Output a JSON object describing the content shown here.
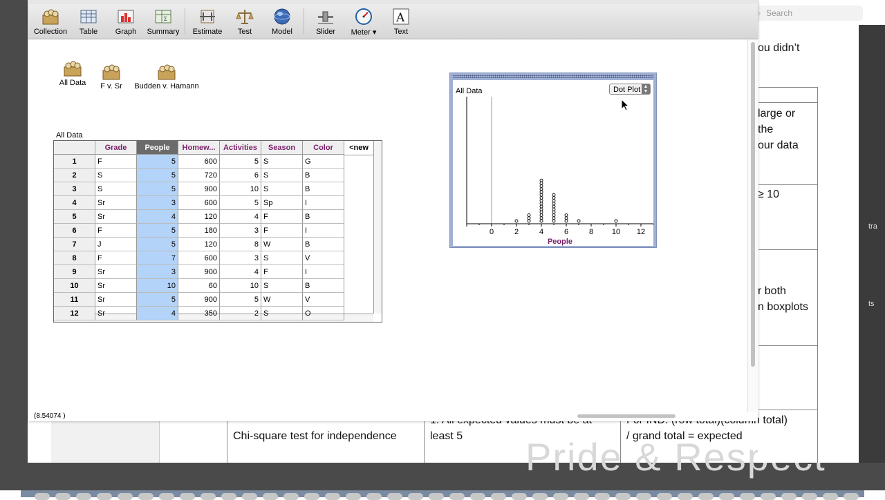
{
  "background": {
    "search_placeholder": "Search",
    "doc_lines": [
      {
        "text": "ou didn’t",
        "x": 1096,
        "y": 58
      },
      {
        "text": "large or",
        "x": 1096,
        "y": 153
      },
      {
        "text": "the",
        "x": 1096,
        "y": 176
      },
      {
        "text": "our data",
        "x": 1096,
        "y": 199
      },
      {
        "text": "≥ 10",
        "x": 1096,
        "y": 270
      },
      {
        "text": "r both",
        "x": 1096,
        "y": 410
      },
      {
        "text": "n boxplots",
        "x": 1096,
        "y": 433
      },
      {
        "text": "Chi-square test for independence",
        "x": 337,
        "y": 620
      },
      {
        "text": "1.  All expected values must be at",
        "x": 622,
        "y": 597
      },
      {
        "text": "least 5",
        "x": 622,
        "y": 620
      },
      {
        "text": "For IND: (row total)(column total)",
        "x": 906,
        "y": 597
      },
      {
        "text": "/ grand total = expected",
        "x": 906,
        "y": 620
      }
    ],
    "strip_labels": [
      "tra",
      "ts"
    ],
    "large_text": "Pride & Respect"
  },
  "toolbar": {
    "items": [
      {
        "label": "Collection",
        "icon": "collection-icon"
      },
      {
        "label": "Table",
        "icon": "table-icon"
      },
      {
        "label": "Graph",
        "icon": "graph-icon"
      },
      {
        "label": "Summary",
        "icon": "summary-icon"
      },
      {
        "label": "Estimate",
        "icon": "estimate-icon"
      },
      {
        "label": "Test",
        "icon": "test-icon"
      },
      {
        "label": "Model",
        "icon": "model-icon"
      },
      {
        "label": "Slider",
        "icon": "slider-icon"
      },
      {
        "label": "Meter ▾",
        "icon": "meter-icon"
      },
      {
        "label": "Text",
        "icon": "text-icon"
      }
    ]
  },
  "collections": [
    {
      "label": "All Data"
    },
    {
      "label": "F v. Sr"
    },
    {
      "label": "Budden v. Hamann"
    }
  ],
  "table": {
    "title": "All Data",
    "columns": [
      "Grade",
      "People",
      "Homew...",
      "Activities",
      "Season",
      "Color"
    ],
    "selected_column": "People",
    "new_column_label": "<new",
    "rows": [
      [
        "1",
        "F",
        "5",
        "600",
        "5",
        "S",
        "G"
      ],
      [
        "2",
        "S",
        "5",
        "720",
        "6",
        "S",
        "B"
      ],
      [
        "3",
        "S",
        "5",
        "900",
        "10",
        "S",
        "B"
      ],
      [
        "4",
        "Sr",
        "3",
        "600",
        "5",
        "Sp",
        "I"
      ],
      [
        "5",
        "Sr",
        "4",
        "120",
        "4",
        "F",
        "B"
      ],
      [
        "6",
        "F",
        "5",
        "180",
        "3",
        "F",
        "I"
      ],
      [
        "7",
        "J",
        "5",
        "120",
        "8",
        "W",
        "B"
      ],
      [
        "8",
        "F",
        "7",
        "600",
        "3",
        "S",
        "V"
      ],
      [
        "9",
        "Sr",
        "3",
        "900",
        "4",
        "F",
        "I"
      ],
      [
        "10",
        "Sr",
        "10",
        "60",
        "10",
        "S",
        "B"
      ],
      [
        "11",
        "Sr",
        "5",
        "900",
        "5",
        "W",
        "V"
      ],
      [
        "12",
        "Sr",
        "4",
        "350",
        "2",
        "S",
        "O"
      ]
    ]
  },
  "graph": {
    "title": "All Data",
    "type_menu": "Dot Plot",
    "xlabel": "People",
    "xticks": [
      "0",
      "2",
      "4",
      "6",
      "8",
      "10",
      "12"
    ]
  },
  "status": {
    "coordinate": "(8.54074 )"
  },
  "chart_data": {
    "type": "scatter",
    "title": "All Data",
    "xlabel": "People",
    "xlim": [
      -2,
      13
    ],
    "ticks": [
      0,
      2,
      4,
      6,
      8,
      10,
      12
    ],
    "dots": [
      {
        "x": 2,
        "count": 1
      },
      {
        "x": 3,
        "count": 3
      },
      {
        "x": 4,
        "count": 15
      },
      {
        "x": 5,
        "count": 10
      },
      {
        "x": 6,
        "count": 3
      },
      {
        "x": 7,
        "count": 1
      },
      {
        "x": 10,
        "count": 1
      }
    ]
  },
  "colors": {
    "accent_header": "#7a1f6b",
    "selected_column": "#b3d3f8",
    "graph_frame": "#9fb0d4"
  }
}
